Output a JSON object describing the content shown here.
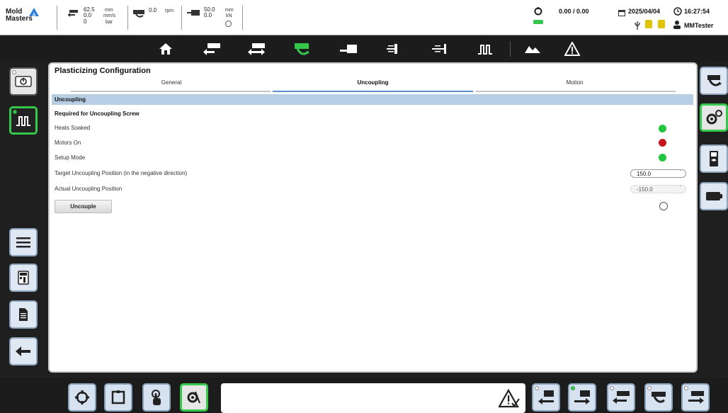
{
  "app": {
    "logo_line1": "Mold",
    "logo_line2": "Masters"
  },
  "status": {
    "injection": {
      "value1": "62.5",
      "unit1": "mm",
      "value2": "0.0",
      "unit2": "mm/s",
      "value3": "0",
      "unit3": "bar"
    },
    "screw": {
      "value": "0.0",
      "unit": "rpm"
    },
    "carriage": {
      "value1": "50.0",
      "unit1": "mm",
      "value2": "0.0",
      "unit2": "kN"
    },
    "cycle": "0.00 / 0.00",
    "date": "2025/04/04",
    "time": "16:27:54",
    "user": "MMTester",
    "colors": {
      "ok_green": "#22c63e",
      "fault_red": "#c8161f",
      "accent_blue": "#5a8fcf",
      "active_border": "#36c84d"
    }
  },
  "nav": {
    "icons": [
      "home-icon",
      "injection-icon",
      "carriage-icon",
      "plasticizing-icon",
      "clamp-icon",
      "ejector-icon",
      "core-icon",
      "heats-icon",
      "mold-icon",
      "alarm-warning-icon"
    ],
    "active": "plasticizing-icon"
  },
  "left_sidebar": {
    "items": [
      "power-icon",
      "heats-icon",
      "menu-icon",
      "calculator-icon",
      "document-icon",
      "back-arrow-icon"
    ],
    "active": "heats-icon"
  },
  "right_sidebar": {
    "items": [
      "plasticizing-icon",
      "settings-gears-icon",
      "screen-monitor-icon",
      "battery-icon"
    ],
    "active": "settings-gears-icon"
  },
  "page": {
    "title": "Plasticizing Configuration",
    "tabs": [
      {
        "label": "General",
        "active": false
      },
      {
        "label": "Uncoupling",
        "active": true
      },
      {
        "label": "Motion",
        "active": false
      }
    ],
    "section_title": "Uncoupling",
    "subsection_title": "Required for Uncoupling Screw",
    "conditions": [
      {
        "label": "Heats Soaked",
        "state": "ok"
      },
      {
        "label": "Motors On",
        "state": "fault"
      },
      {
        "label": "Setup Mode",
        "state": "ok"
      }
    ],
    "target_position": {
      "label": "Target Uncoupling Position (in the negative direction)",
      "value": "150.0"
    },
    "actual_position": {
      "label": "Actual Uncoupling Position",
      "value": "-150.0"
    },
    "uncouple_button": "Uncouple"
  },
  "bottom_bar": {
    "left_buttons": [
      "cycle-start-icon",
      "stop-square-icon",
      "touch-hand-icon",
      "settings-cog-icon"
    ],
    "active_left": "settings-cog-icon",
    "right_buttons": [
      "carriage-back-icon",
      "carriage-forward-icon",
      "injection-back-icon",
      "screw-rotate-icon",
      "injection-forward-icon"
    ]
  }
}
